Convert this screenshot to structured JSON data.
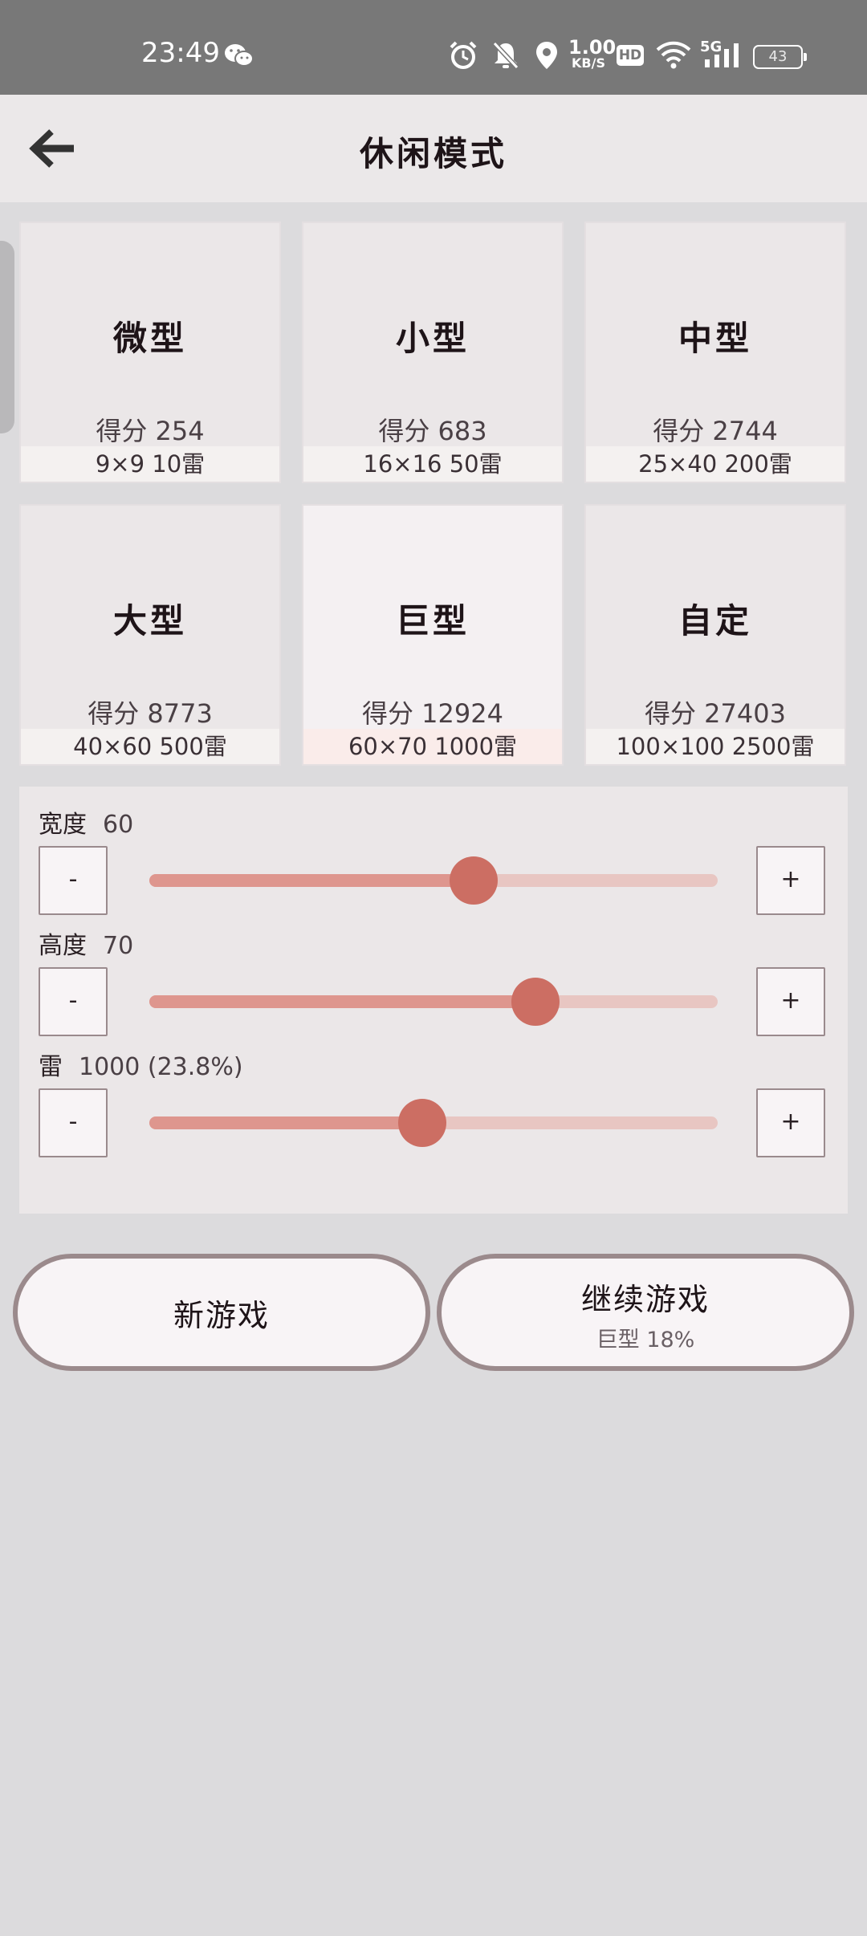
{
  "status_bar": {
    "time": "23:49",
    "net_speed": "1.00",
    "net_speed_unit": "KB/S",
    "hd_badge": "HD",
    "network_type": "5G",
    "battery": "43",
    "icons": [
      "wechat-icon",
      "alarm-icon",
      "mute-bell-icon",
      "location-icon",
      "wifi-icon",
      "signal-icon",
      "battery-icon"
    ]
  },
  "header": {
    "title": "休闲模式",
    "back_icon": "arrow-left-icon"
  },
  "modes": [
    {
      "name": "微型",
      "score": "得分 254",
      "spec": "9×9  10雷"
    },
    {
      "name": "小型",
      "score": "得分 683",
      "spec": "16×16  50雷"
    },
    {
      "name": "中型",
      "score": "得分 2744",
      "spec": "25×40  200雷"
    },
    {
      "name": "大型",
      "score": "得分 8773",
      "spec": "40×60  500雷"
    },
    {
      "name": "巨型",
      "score": "得分 12924",
      "spec": "60×70  1000雷",
      "selected": true
    },
    {
      "name": "自定",
      "score": "得分 27403",
      "spec": "100×100  2500雷"
    }
  ],
  "custom": {
    "width": {
      "label": "宽度",
      "value": "60",
      "fraction": 0.57
    },
    "height": {
      "label": "高度",
      "value": "70",
      "fraction": 0.68
    },
    "mines": {
      "label": "雷",
      "value": "1000 (23.8%)",
      "fraction": 0.48
    },
    "minus_label": "-",
    "plus_label": "+"
  },
  "actions": {
    "new_game": "新游戏",
    "continue_game": "继续游戏",
    "continue_sub": "巨型 18%"
  },
  "colors": {
    "accent": "#cc6e63",
    "track_fill": "#de968e",
    "track_bg": "#e8c6c2",
    "status_bar": "#787878"
  }
}
